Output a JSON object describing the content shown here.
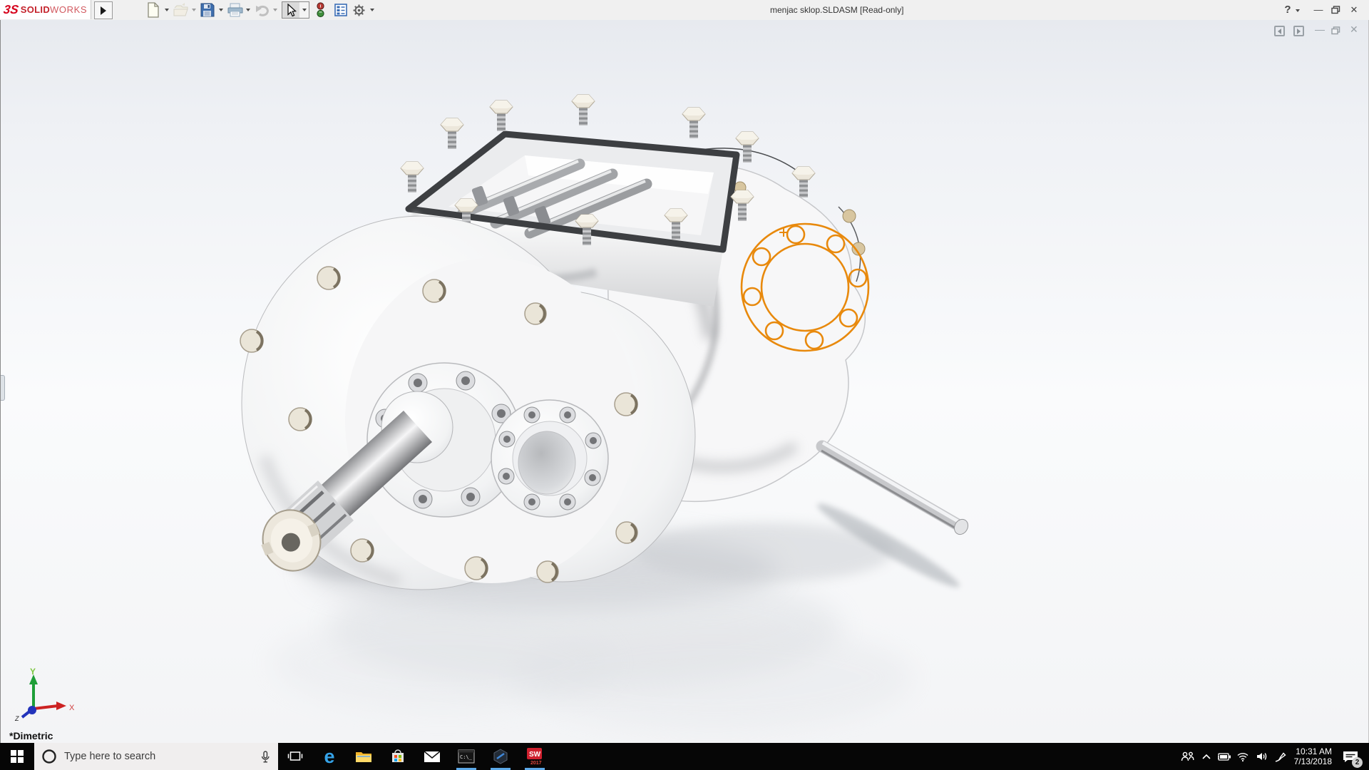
{
  "titlebar": {
    "brand": {
      "mark": "3S",
      "bold": "SOLID",
      "light": "WORKS"
    },
    "title": "menjac sklop.SLDASM [Read-only]",
    "help": "?",
    "toolbar_icons": [
      {
        "name": "new-document"
      },
      {
        "name": "open"
      },
      {
        "name": "save"
      },
      {
        "name": "print"
      },
      {
        "name": "undo"
      },
      {
        "name": "select-cursor"
      },
      {
        "name": "rebuild-traffic-light"
      },
      {
        "name": "task-pane-list"
      },
      {
        "name": "settings-gear"
      }
    ],
    "window": {
      "minimize": "—",
      "close": "✕"
    }
  },
  "docwindow": {
    "icons": [
      "pane-collapse-left",
      "pane-collapse-right",
      "minimize",
      "restore",
      "close"
    ],
    "minimize": "—",
    "close": "✕"
  },
  "viewport": {
    "orientation": "*Dimetric",
    "triad": {
      "x": "X",
      "y": "Y",
      "z": "Z"
    },
    "model_name": "gearbox-assembly"
  },
  "colors": {
    "selection_orange": "#E8890C",
    "brand_red": "#d6001c",
    "running_indicator": "#5ca9e8"
  },
  "taskbar": {
    "search": {
      "placeholder": "Type here to search"
    },
    "apps": [
      {
        "name": "task-view",
        "running": false
      },
      {
        "name": "edge",
        "running": false,
        "glyph": "e"
      },
      {
        "name": "file-explorer",
        "running": false
      },
      {
        "name": "microsoft-store",
        "running": false
      },
      {
        "name": "mail",
        "running": false
      },
      {
        "name": "command-prompt",
        "running": true,
        "text": "C:\\_"
      },
      {
        "name": "hexagon-app",
        "running": true
      },
      {
        "name": "solidworks-2017",
        "running": true,
        "label": "SW",
        "year": "2017"
      }
    ],
    "tray": {
      "icons": [
        "people",
        "chevron-up",
        "battery",
        "wifi",
        "volume",
        "pen"
      ],
      "time": "10:31 AM",
      "date": "7/13/2018",
      "badge": "2"
    }
  }
}
